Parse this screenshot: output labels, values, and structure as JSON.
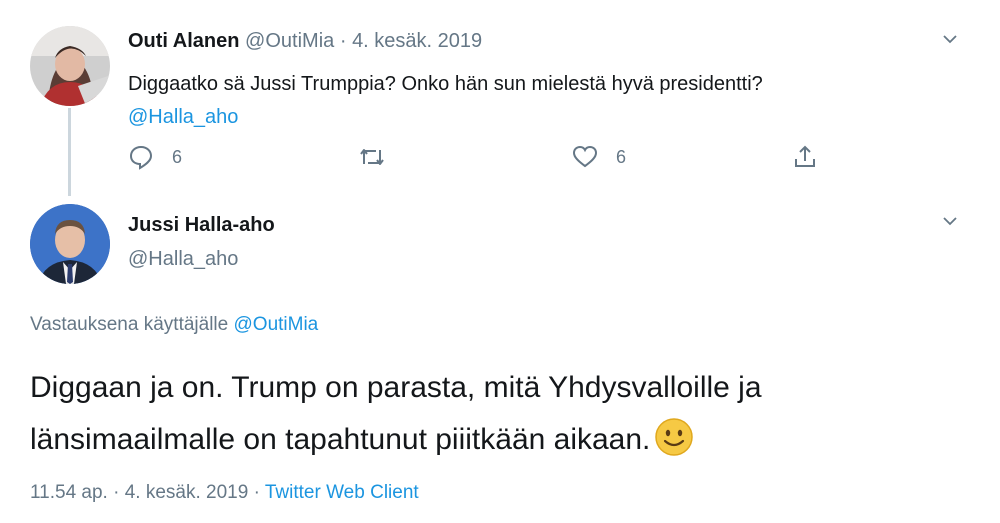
{
  "tweet1": {
    "display_name": "Outi Alanen",
    "handle": "@OutiMia",
    "separator": "·",
    "date": "4. kesäk. 2019",
    "text": "Diggaatko sä Jussi Trumppia? Onko hän sun mielestä hyvä presidentti?",
    "mention": "@Halla_aho",
    "actions": {
      "reply_count": "6",
      "like_count": "6"
    }
  },
  "tweet2": {
    "display_name": "Jussi Halla-aho",
    "handle": "@Halla_aho",
    "reply_to_prefix": "Vastauksena käyttäjälle",
    "reply_to_mention": "@OutiMia",
    "text_line1": "Diggaan ja on. Trump on parasta, mitä Yhdysvalloille ja",
    "text_line2": "länsimaailmalle on tapahtunut piiitkään aikaan.",
    "emoji": "slightly-smiling-face",
    "time": "11.54 ap.",
    "separator": "·",
    "date": "4. kesäk. 2019",
    "client": "Twitter Web Client"
  },
  "colors": {
    "link": "#1b95e0",
    "muted": "#657786",
    "text": "#14171a",
    "thread_line": "#ccd6dd"
  }
}
